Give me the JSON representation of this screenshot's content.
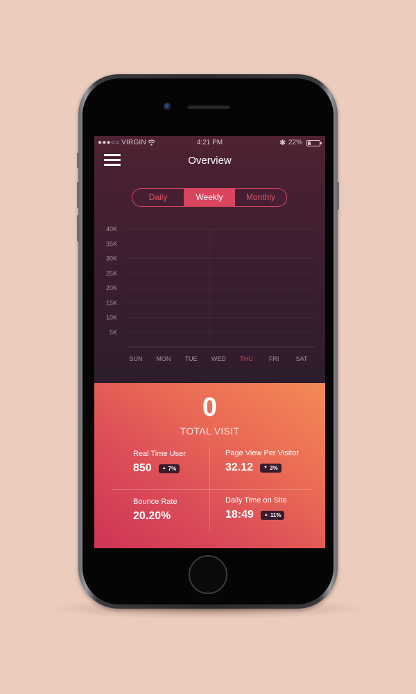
{
  "status_bar": {
    "carrier": "●●●○○ VIRGIN",
    "time": "4:21 PM",
    "battery": "22%",
    "battery_level": 0.22
  },
  "header": {
    "title": "Overview",
    "menu_icon": "hamburger-menu-icon"
  },
  "segments": [
    {
      "label": "Daily",
      "selected": false
    },
    {
      "label": "Weekly",
      "selected": true
    },
    {
      "label": "Monthly",
      "selected": false
    }
  ],
  "chart_data": {
    "type": "line",
    "categories": [
      "SUN",
      "MON",
      "TUE",
      "WED",
      "THU",
      "FRI",
      "SAT"
    ],
    "highlighted_category": "THU",
    "yticks": [
      "5K",
      "10K",
      "15K",
      "20K",
      "25K",
      "30K",
      "35K",
      "40K"
    ],
    "ylim": [
      0,
      40000
    ],
    "series": [],
    "grid": true,
    "highlight_color": "#d9445f"
  },
  "summary": {
    "total_visits": "0",
    "total_label": "TOTAL VISIT"
  },
  "stats": [
    {
      "label": "Real Time User",
      "value": "850",
      "change": "7%",
      "direction": "up"
    },
    {
      "label": "Page View Per Visitor",
      "value": "32.12",
      "change": "3%",
      "direction": "down"
    },
    {
      "label": "Bounce Rate",
      "value": "20.20%"
    },
    {
      "label": "Daily Time on Site",
      "value": "18:49",
      "change": "11%",
      "direction": "up"
    }
  ]
}
